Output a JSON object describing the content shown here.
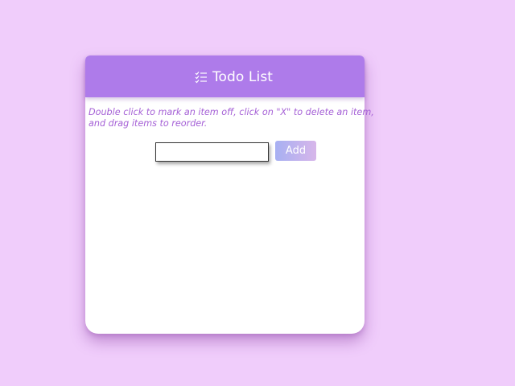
{
  "header": {
    "title": "Todo List",
    "icon": "list-check-icon",
    "color": "#ae7bea"
  },
  "instructions": {
    "line1": " Double click to mark an item off, click on \"X\" to delete an item,",
    "line2": "and drag items to reorder."
  },
  "input": {
    "value": "",
    "placeholder": ""
  },
  "add_button": {
    "label": "Add"
  },
  "items": [],
  "colors": {
    "background": "#f0cdfb",
    "accent": "#ae7bea",
    "instructions_text": "#a560d6"
  }
}
